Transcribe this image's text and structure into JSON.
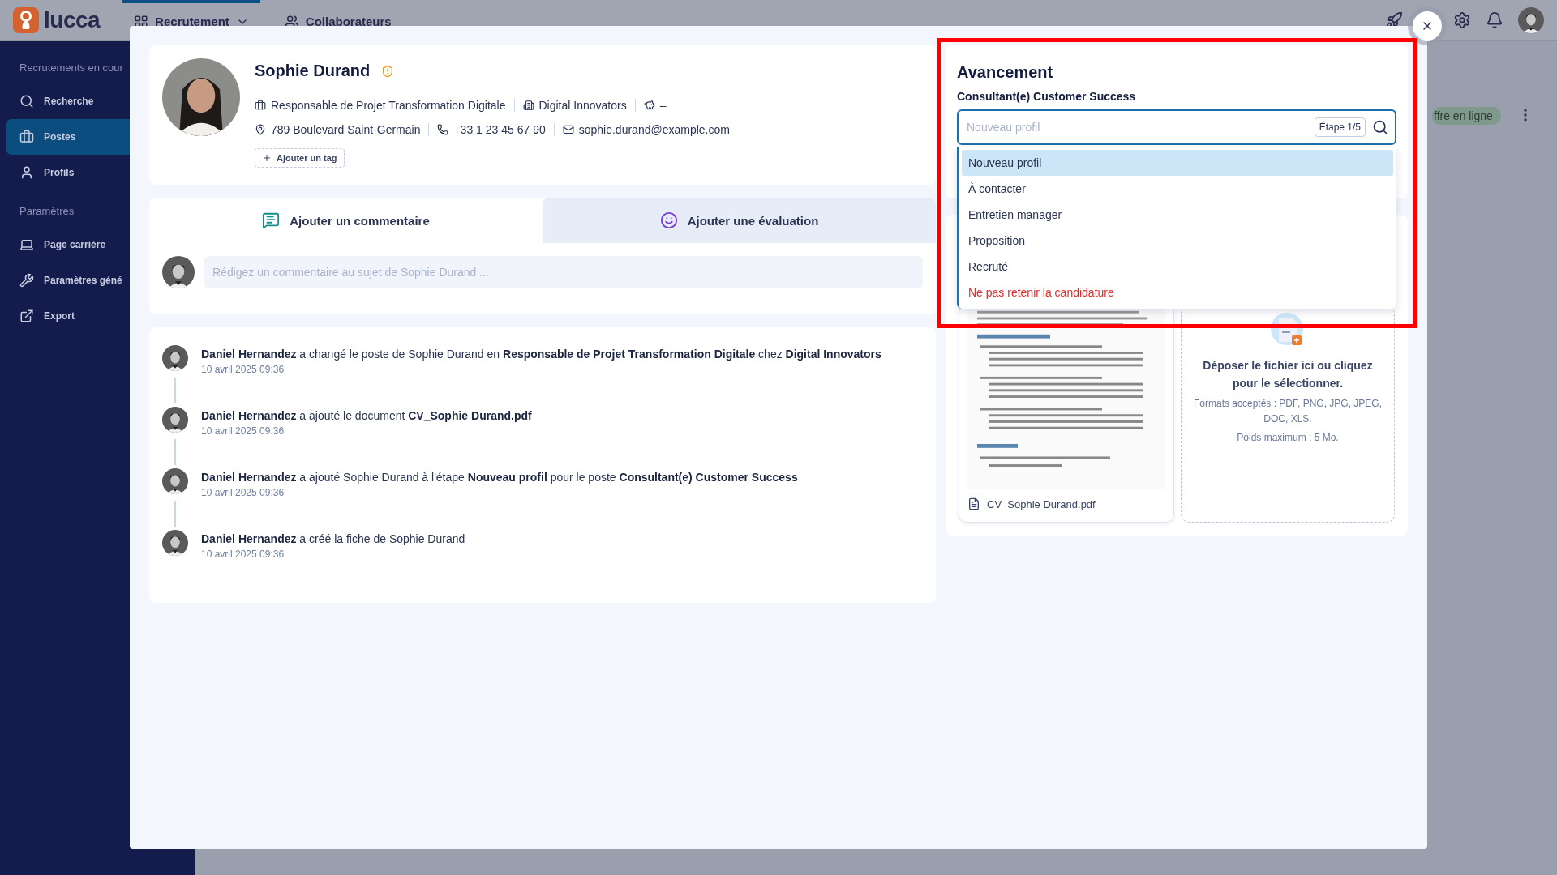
{
  "topbar": {
    "logo": "lucca",
    "nav": [
      {
        "label": "Recrutement",
        "selected": true,
        "kind": "menu"
      },
      {
        "label": "Collaborateurs",
        "selected": false,
        "kind": "link"
      }
    ]
  },
  "sidebar": {
    "sections": [
      {
        "title": "Recrutements en cour",
        "items": [
          {
            "label": "Recherche",
            "selected": false
          },
          {
            "label": "Postes",
            "selected": true
          },
          {
            "label": "Profils",
            "selected": false
          }
        ]
      },
      {
        "title": "Paramètres",
        "items": [
          {
            "label": "Page carrière",
            "selected": false
          },
          {
            "label": "Paramètres géné",
            "selected": false
          },
          {
            "label": "Export",
            "selected": false
          }
        ]
      }
    ]
  },
  "background": {
    "badge": "ffre en ligne"
  },
  "profile": {
    "name": "Sophie Durand",
    "rows": [
      [
        {
          "kind": "job",
          "text": "Responsable de Projet Transformation Digitale"
        },
        {
          "kind": "company",
          "text": "Digital Innovators"
        },
        {
          "kind": "salary",
          "text": "–"
        }
      ],
      [
        {
          "kind": "address",
          "text": "789 Boulevard Saint-Germain"
        },
        {
          "kind": "phone",
          "text": "+33 1 23 45 67 90"
        },
        {
          "kind": "email",
          "text": "sophie.durand@example.com"
        }
      ]
    ],
    "tag_button": "Ajouter un tag"
  },
  "comment_tabs": [
    {
      "label": "Ajouter un commentaire",
      "selected": true
    },
    {
      "label": "Ajouter une évaluation",
      "selected": false
    }
  ],
  "comment_field": {
    "placeholder": "Rédigez un commentaire au sujet de Sophie Durand ..."
  },
  "activity": [
    {
      "text": "**Daniel Hernandez** a changé le poste de Sophie Durand en **Responsable de Projet Transformation Digitale** chez **Digital Innovators**",
      "time": "10 avril 2025 09:36"
    },
    {
      "text": "**Daniel Hernandez** a ajouté le document **CV_Sophie Durand.pdf**",
      "time": "10 avril 2025 09:36"
    },
    {
      "text": "**Daniel Hernandez** a ajouté Sophie Durand à l'étape **Nouveau profil** pour le poste **Consultant(e) Customer Success**",
      "time": "10 avril 2025 09:36"
    },
    {
      "text": "**Daniel Hernandez** a créé la fiche de Sophie Durand",
      "time": "10 avril 2025 09:36"
    }
  ],
  "progress": {
    "title": "Avancement",
    "job": "Consultant(e) Customer Success",
    "field": {
      "placeholder": "Nouveau profil"
    },
    "step": "Étape 1/5",
    "options": [
      {
        "label": "Nouveau profil",
        "selected": true,
        "kind": "stage"
      },
      {
        "label": "À contacter",
        "selected": false,
        "kind": "stage"
      },
      {
        "label": "Entretien manager",
        "selected": false,
        "kind": "stage"
      },
      {
        "label": "Proposition",
        "selected": false,
        "kind": "stage"
      },
      {
        "label": "Recruté",
        "selected": false,
        "kind": "stage"
      },
      {
        "label": "Ne pas retenir la candidature",
        "selected": false,
        "kind": "reject"
      }
    ]
  },
  "documents": {
    "file_name": "CV_Sophie Durand.pdf",
    "upload_title": "Déposer le fichier ici ou cliquez pour le sélectionner.",
    "upload_formats": "Formats acceptés : PDF, PNG, JPG, JPEG, DOC, XLS.",
    "upload_max": "Poids maximum : 5 Mo."
  }
}
